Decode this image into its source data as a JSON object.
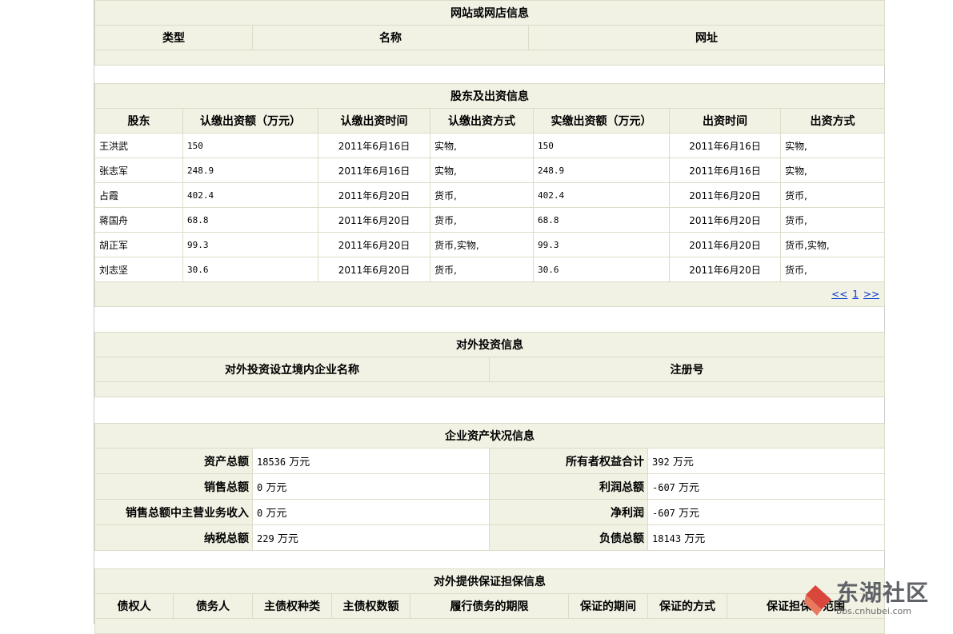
{
  "website": {
    "title": "网站或网店信息",
    "headers": [
      "类型",
      "名称",
      "网址"
    ]
  },
  "shareholders": {
    "title": "股东及出资信息",
    "headers": [
      "股东",
      "认缴出资额（万元）",
      "认缴出资时间",
      "认缴出资方式",
      "实缴出资额（万元）",
      "出资时间",
      "出资方式"
    ],
    "rows": [
      [
        "王洪武",
        "150",
        "2011年6月16日",
        "实物,",
        "150",
        "2011年6月16日",
        "实物,"
      ],
      [
        "张志军",
        "248.9",
        "2011年6月16日",
        "实物,",
        "248.9",
        "2011年6月16日",
        "实物,"
      ],
      [
        "占霞",
        "402.4",
        "2011年6月20日",
        "货币,",
        "402.4",
        "2011年6月20日",
        "货币,"
      ],
      [
        "蒋国舟",
        "68.8",
        "2011年6月20日",
        "货币,",
        "68.8",
        "2011年6月20日",
        "货币,"
      ],
      [
        "胡正军",
        "99.3",
        "2011年6月20日",
        "货币,实物,",
        "99.3",
        "2011年6月20日",
        "货币,实物,"
      ],
      [
        "刘志坚",
        "30.6",
        "2011年6月20日",
        "货币,",
        "30.6",
        "2011年6月20日",
        "货币,"
      ]
    ],
    "pager": {
      "prev": "<<",
      "page": "1",
      "next": ">>"
    }
  },
  "investment": {
    "title": "对外投资信息",
    "headers": [
      "对外投资设立境内企业名称",
      "注册号"
    ]
  },
  "assets": {
    "title": "企业资产状况信息",
    "rows": [
      {
        "l1": "资产总额",
        "v1": "18536",
        "u1": "万元",
        "l2": "所有者权益合计",
        "v2": "392",
        "u2": "万元"
      },
      {
        "l1": "销售总额",
        "v1": "0",
        "u1": "万元",
        "l2": "利润总额",
        "v2": "-607",
        "u2": "万元"
      },
      {
        "l1": "销售总额中主营业务收入",
        "v1": "0",
        "u1": "万元",
        "l2": "净利润",
        "v2": "-607",
        "u2": "万元"
      },
      {
        "l1": "纳税总额",
        "v1": "229",
        "u1": "万元",
        "l2": "负债总额",
        "v2": "18143",
        "u2": "万元"
      }
    ]
  },
  "guarantee": {
    "title": "对外提供保证担保信息",
    "headers": [
      "债权人",
      "债务人",
      "主债权种类",
      "主债权数额",
      "履行债务的期限",
      "保证的期间",
      "保证的方式",
      "保证担保的范围"
    ]
  },
  "watermark": {
    "title": "东湖社区",
    "url": "bbs.cnhubei.com",
    "color": "#d9473c"
  }
}
